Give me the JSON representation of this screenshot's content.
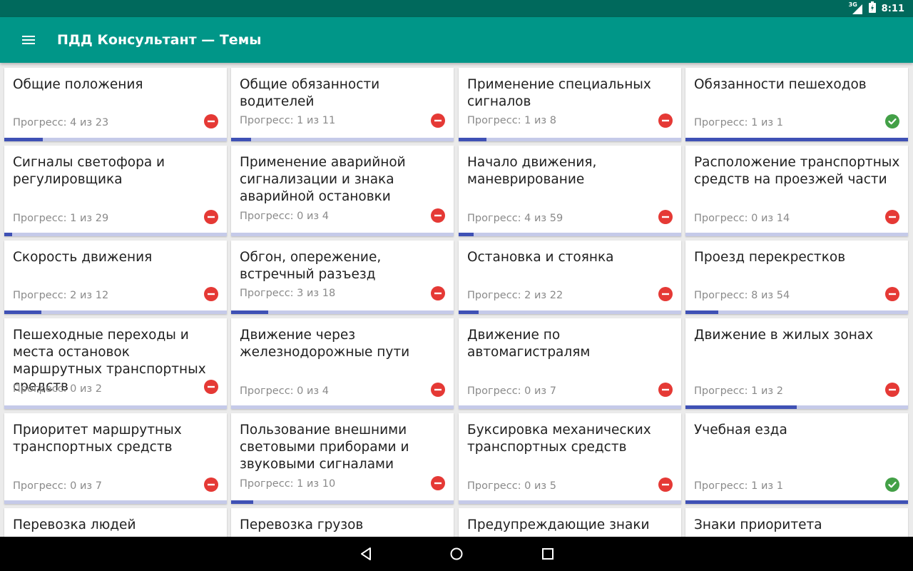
{
  "status_bar": {
    "network": "3G",
    "time": "8:11"
  },
  "app_bar": {
    "title": "ПДД Консультант — Темы"
  },
  "colors": {
    "status_bar": "#00695c",
    "app_bar": "#009688",
    "progress_track": "#c5cae9",
    "progress_fill": "#3f51b5",
    "status_incomplete": "#e53935",
    "status_complete": "#43a047"
  },
  "topics": [
    {
      "title": "Общие положения",
      "progress_text": "Прогресс: 4 из 23",
      "done": 4,
      "total": 23,
      "status": "incomplete"
    },
    {
      "title": "Общие обязанности водителей",
      "progress_text": "Прогресс: 1 из 11",
      "done": 1,
      "total": 11,
      "status": "incomplete"
    },
    {
      "title": "Применение специальных сигналов",
      "progress_text": "Прогресс: 1 из 8",
      "done": 1,
      "total": 8,
      "status": "incomplete"
    },
    {
      "title": "Обязанности пешеходов",
      "progress_text": "Прогресс: 1 из 1",
      "done": 1,
      "total": 1,
      "status": "complete"
    },
    {
      "title": "Сигналы светофора и регулировщика",
      "progress_text": "Прогресс: 1 из 29",
      "done": 1,
      "total": 29,
      "status": "incomplete"
    },
    {
      "title": "Применение аварийной сигнализации и знака аварийной остановки",
      "progress_text": "Прогресс: 0 из 4",
      "done": 0,
      "total": 4,
      "status": "incomplete"
    },
    {
      "title": "Начало движения, маневрирование",
      "progress_text": "Прогресс: 4 из 59",
      "done": 4,
      "total": 59,
      "status": "incomplete"
    },
    {
      "title": "Расположение транспортных средств на проезжей части",
      "progress_text": "Прогресс: 0 из 14",
      "done": 0,
      "total": 14,
      "status": "incomplete"
    },
    {
      "title": "Скорость движения",
      "progress_text": "Прогресс: 2 из 12",
      "done": 2,
      "total": 12,
      "status": "incomplete"
    },
    {
      "title": "Обгон, опережение, встречный разъезд",
      "progress_text": "Прогресс: 3 из 18",
      "done": 3,
      "total": 18,
      "status": "incomplete"
    },
    {
      "title": "Остановка и стоянка",
      "progress_text": "Прогресс: 2 из 22",
      "done": 2,
      "total": 22,
      "status": "incomplete"
    },
    {
      "title": "Проезд перекрестков",
      "progress_text": "Прогресс: 8 из 54",
      "done": 8,
      "total": 54,
      "status": "incomplete"
    },
    {
      "title": "Пешеходные переходы и места остановок маршрутных транспортных средств",
      "progress_text": "Прогресс: 0 из 2",
      "done": 0,
      "total": 2,
      "status": "incomplete"
    },
    {
      "title": "Движение через железнодорожные пути",
      "progress_text": "Прогресс: 0 из 4",
      "done": 0,
      "total": 4,
      "status": "incomplete"
    },
    {
      "title": "Движение по автомагистралям",
      "progress_text": "Прогресс: 0 из 7",
      "done": 0,
      "total": 7,
      "status": "incomplete"
    },
    {
      "title": "Движение в жилых зонах",
      "progress_text": "Прогресс: 1 из 2",
      "done": 1,
      "total": 2,
      "status": "incomplete"
    },
    {
      "title": "Приоритет маршрутных транспортных средств",
      "progress_text": "Прогресс: 0 из 7",
      "done": 0,
      "total": 7,
      "status": "incomplete"
    },
    {
      "title": "Пользование внешними световыми приборами и звуковыми сигналами",
      "progress_text": "Прогресс: 1 из 10",
      "done": 1,
      "total": 10,
      "status": "incomplete"
    },
    {
      "title": "Буксировка механических транспортных средств",
      "progress_text": "Прогресс: 0 из 5",
      "done": 0,
      "total": 5,
      "status": "incomplete"
    },
    {
      "title": "Учебная езда",
      "progress_text": "Прогресс: 1 из 1",
      "done": 1,
      "total": 1,
      "status": "complete"
    },
    {
      "title": "Перевозка людей",
      "progress_text": "",
      "done": null,
      "total": null,
      "status": null
    },
    {
      "title": "Перевозка грузов",
      "progress_text": "",
      "done": null,
      "total": null,
      "status": null
    },
    {
      "title": "Предупреждающие знаки",
      "progress_text": "",
      "done": null,
      "total": null,
      "status": null
    },
    {
      "title": "Знаки приоритета",
      "progress_text": "",
      "done": null,
      "total": null,
      "status": null
    }
  ]
}
